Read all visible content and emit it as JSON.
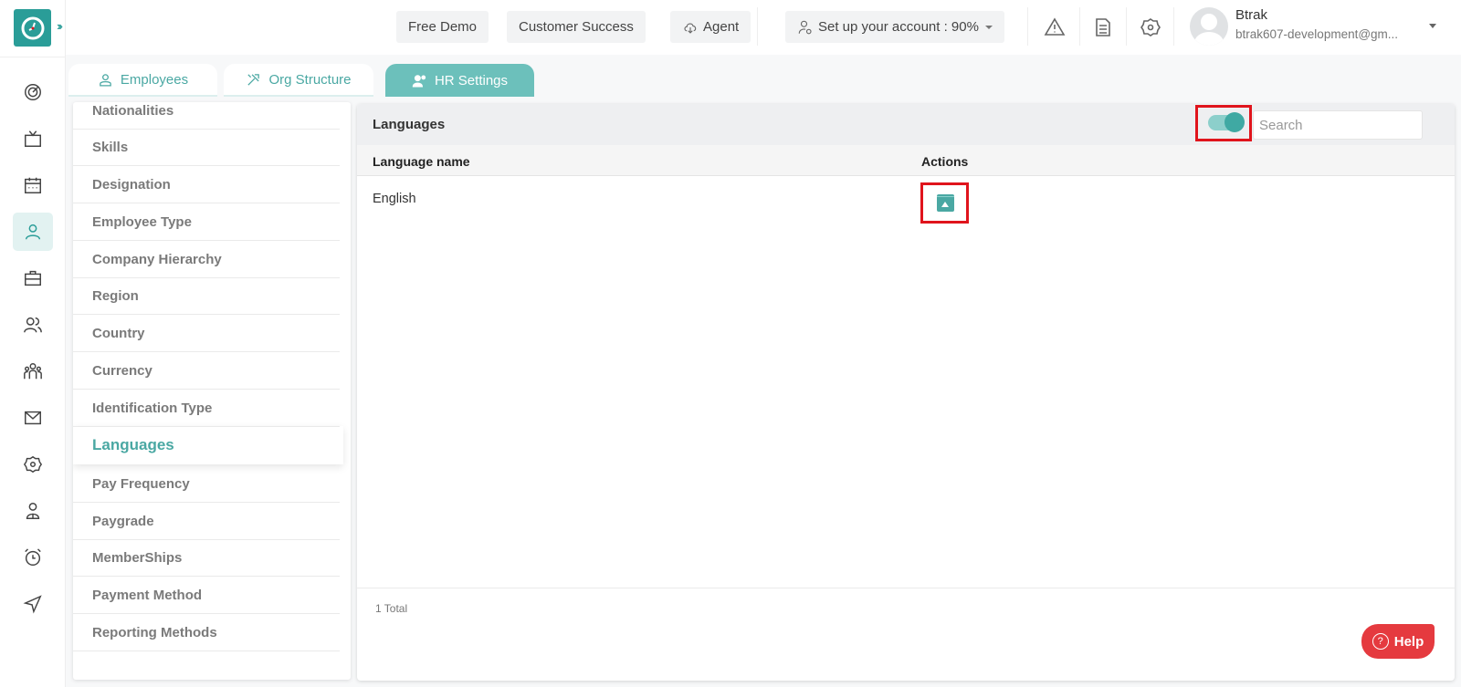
{
  "app": {
    "logo_icon": "clock-logo-icon",
    "expand_icon": "chevrons-right-icon",
    "brand_color": "#2a9d98"
  },
  "leftnav": {
    "items": [
      {
        "icon": "target-icon",
        "active": false
      },
      {
        "icon": "tv-icon",
        "active": false
      },
      {
        "icon": "calendar-icon",
        "active": false
      },
      {
        "icon": "user-icon",
        "active": true
      },
      {
        "icon": "briefcase-icon",
        "active": false
      },
      {
        "icon": "users-icon",
        "active": false
      },
      {
        "icon": "team-icon",
        "active": false
      },
      {
        "icon": "mail-icon",
        "active": false
      },
      {
        "icon": "gear-icon",
        "active": false
      },
      {
        "icon": "user-badge-icon",
        "active": false
      },
      {
        "icon": "alarm-clock-icon",
        "active": false
      },
      {
        "icon": "send-icon",
        "active": false
      }
    ]
  },
  "topbar": {
    "free_demo": "Free Demo",
    "customer_success": "Customer Success",
    "agent": "Agent",
    "setup_account": "Set up your account : 90%",
    "setup_progress_percent": 90,
    "user_name": "Btrak",
    "user_email": "btrak607-development@gm..."
  },
  "tabs": [
    {
      "label": "Employees",
      "icon": "user-icon",
      "active": false
    },
    {
      "label": "Org Structure",
      "icon": "tools-icon",
      "active": false
    },
    {
      "label": "HR Settings",
      "icon": "user-settings-icon",
      "active": true
    }
  ],
  "sidebar": {
    "items": [
      {
        "label": "Nationalities"
      },
      {
        "label": "Skills"
      },
      {
        "label": "Designation"
      },
      {
        "label": "Employee Type"
      },
      {
        "label": "Company Hierarchy"
      },
      {
        "label": "Region"
      },
      {
        "label": "Country"
      },
      {
        "label": "Currency"
      },
      {
        "label": "Identification Type"
      },
      {
        "label": "Languages",
        "active": true
      },
      {
        "label": "Pay Frequency"
      },
      {
        "label": "Paygrade"
      },
      {
        "label": "MemberShips"
      },
      {
        "label": "Payment Method"
      },
      {
        "label": "Reporting Methods"
      }
    ]
  },
  "panel": {
    "title": "Languages",
    "archive_toggle_on": true,
    "search_placeholder": "Search",
    "search_value": "",
    "columns": [
      "Language name",
      "Actions"
    ],
    "rows": [
      {
        "name": "English",
        "action_icon": "unarchive-icon"
      }
    ],
    "total": "1 Total"
  },
  "help": {
    "label": "Help",
    "color": "#e53a3f"
  }
}
